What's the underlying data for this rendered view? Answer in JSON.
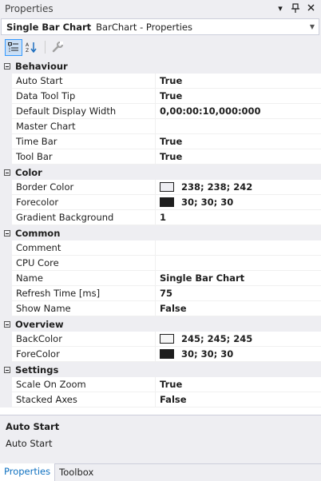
{
  "window": {
    "title": "Properties"
  },
  "object_selector": {
    "name": "Single Bar Chart",
    "type": "BarChart - Properties"
  },
  "title_icons": {
    "dropdown": "dropdown-arrow",
    "pin": "pin-icon",
    "close": "close-icon"
  },
  "categories": [
    {
      "name": "Behaviour",
      "props": [
        {
          "name": "Auto Start",
          "value": "True"
        },
        {
          "name": "Data Tool Tip",
          "value": "True"
        },
        {
          "name": "Default Display Width",
          "value": "0,00:00:10,000:000"
        },
        {
          "name": "Master Chart",
          "value": ""
        },
        {
          "name": "Time Bar",
          "value": "True"
        },
        {
          "name": "Tool Bar",
          "value": "True"
        }
      ]
    },
    {
      "name": "Color",
      "props": [
        {
          "name": "Border Color",
          "value": "238; 238; 242",
          "swatch": "#eeeef2"
        },
        {
          "name": "Forecolor",
          "value": "30; 30; 30",
          "swatch": "#1e1e1e"
        },
        {
          "name": "Gradient Background",
          "value": "1"
        }
      ]
    },
    {
      "name": "Common",
      "props": [
        {
          "name": "Comment",
          "value": ""
        },
        {
          "name": "CPU Core",
          "value": ""
        },
        {
          "name": "Name",
          "value": "Single Bar Chart"
        },
        {
          "name": "Refresh Time [ms]",
          "value": "75"
        },
        {
          "name": "Show Name",
          "value": "False"
        }
      ]
    },
    {
      "name": "Overview",
      "props": [
        {
          "name": "BackColor",
          "value": "245; 245; 245",
          "swatch": "#f5f5f5"
        },
        {
          "name": "ForeColor",
          "value": "30; 30; 30",
          "swatch": "#1e1e1e"
        }
      ]
    },
    {
      "name": "Settings",
      "props": [
        {
          "name": "Scale On Zoom",
          "value": "True"
        },
        {
          "name": "Stacked Axes",
          "value": "False"
        }
      ]
    }
  ],
  "description": {
    "title": "Auto Start",
    "text": "Auto Start"
  },
  "tabs": [
    {
      "label": "Properties",
      "active": true
    },
    {
      "label": "Toolbox",
      "active": false
    }
  ]
}
